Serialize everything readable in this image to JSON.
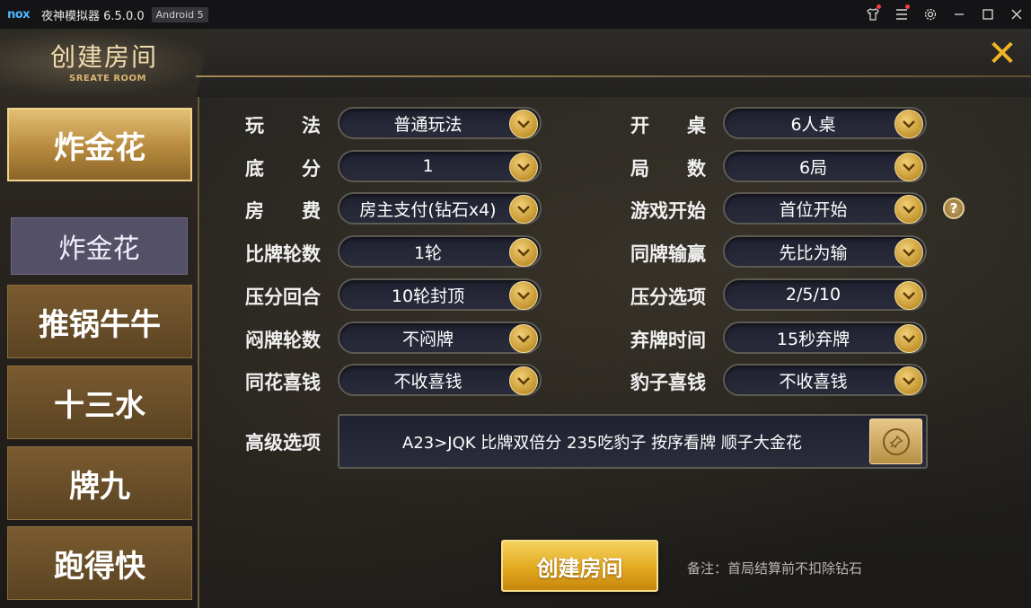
{
  "titlebar": {
    "logo": "nox",
    "title": "夜神模拟器 6.5.0.0",
    "android_badge": "Android 5",
    "icons": [
      "shirt-icon",
      "menu-icon",
      "gear-icon",
      "minimize-icon",
      "maximize-icon",
      "close-icon"
    ]
  },
  "header": {
    "title": "创建房间",
    "subtitle": "SREATE ROOM",
    "close_symbol": "✕"
  },
  "sidebar": {
    "tabs": [
      {
        "label": "炸金花",
        "active": true
      },
      {
        "label": "推锅牛牛",
        "active": false
      },
      {
        "label": "十三水",
        "active": false
      },
      {
        "label": "牌九",
        "active": false
      },
      {
        "label": "跑得快",
        "active": false
      }
    ],
    "subtab": "炸金花"
  },
  "form": {
    "left": [
      {
        "label": "玩　　法",
        "value": "普通玩法"
      },
      {
        "label": "底　　分",
        "value": "1"
      },
      {
        "label": "房　　费",
        "value": "房主支付(钻石x4)"
      },
      {
        "label": "比牌轮数",
        "value": "1轮"
      },
      {
        "label": "压分回合",
        "value": "10轮封顶"
      },
      {
        "label": "闷牌轮数",
        "value": "不闷牌"
      },
      {
        "label": "同花喜钱",
        "value": "不收喜钱"
      }
    ],
    "right": [
      {
        "label": "开　　桌",
        "value": "6人桌"
      },
      {
        "label": "局　　数",
        "value": "6局"
      },
      {
        "label": "游戏开始",
        "value": "首位开始"
      },
      {
        "label": "同牌输赢",
        "value": "先比为输"
      },
      {
        "label": "压分选项",
        "value": "2/5/10"
      },
      {
        "label": "弃牌时间",
        "value": "15秒弃牌"
      },
      {
        "label": "豹子喜钱",
        "value": "不收喜钱"
      }
    ],
    "help_symbol": "?",
    "advanced_label": "高级选项",
    "advanced_value": "A23>JQK 比牌双倍分 235吃豹子 按序看牌 顺子大金花"
  },
  "footer": {
    "create_button": "创建房间",
    "note": "备注：首局结算前不扣除钻石"
  },
  "colors": {
    "accent_gold": "#e3a91f",
    "title_gold": "#f1dcae",
    "close_orange": "#f3b526",
    "subtab_purple": "#545067"
  }
}
